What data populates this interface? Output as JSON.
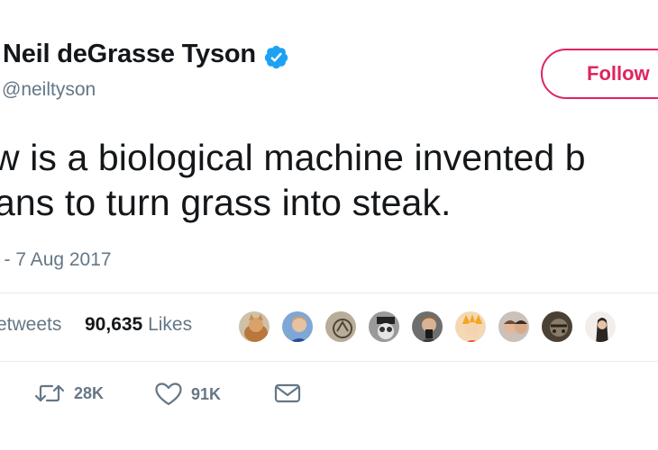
{
  "author": {
    "name": "Neil deGrasse Tyson",
    "handle": "@neiltyson",
    "verified_icon": "verified-badge-icon",
    "verified_color": "#1da1f2"
  },
  "follow_button": {
    "label": "Follow",
    "color": "#e0245e"
  },
  "tweet": {
    "line1": "w is a biological machine invented b",
    "line2": "ans to turn grass into steak."
  },
  "timestamp": "l - 7 Aug 2017",
  "stats": {
    "retweets_label": "etweets",
    "likes_count": "90,635",
    "likes_label": "Likes"
  },
  "liker_avatars": [
    "avatar-1",
    "avatar-2",
    "avatar-3",
    "avatar-4",
    "avatar-5",
    "avatar-6",
    "avatar-7",
    "avatar-8",
    "avatar-9"
  ],
  "actions": {
    "reply_icon": "reply-icon",
    "retweet_icon": "retweet-icon",
    "retweet_count": "28K",
    "like_icon": "heart-icon",
    "like_count": "91K",
    "dm_icon": "envelope-icon"
  },
  "colors": {
    "text": "#14171a",
    "secondary": "#657786",
    "border": "#e6ecf0"
  }
}
